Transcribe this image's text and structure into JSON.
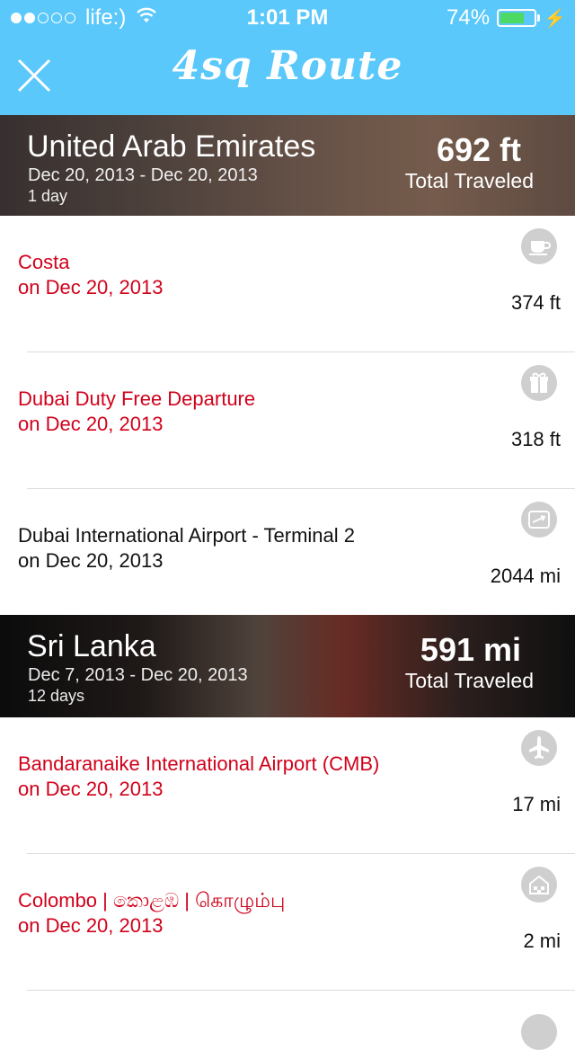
{
  "status_bar": {
    "carrier": "life:)",
    "time": "1:01 PM",
    "battery": "74%",
    "battery_level": 0.74
  },
  "header": {
    "title": "4sq Route"
  },
  "sections": [
    {
      "country": "United Arab Emirates",
      "date_range": "Dec 20, 2013 - Dec 20, 2013",
      "duration": "1 day",
      "total_distance": "692 ft",
      "total_label": "Total Traveled",
      "checkins": [
        {
          "venue": "Costa",
          "date": "on Dec 20, 2013",
          "distance": "374 ft",
          "icon": "coffee-icon",
          "color": "#d0021b"
        },
        {
          "venue": "Dubai Duty Free Departure",
          "date": "on Dec 20, 2013",
          "distance": "318 ft",
          "icon": "gift-icon",
          "color": "#d0021b"
        },
        {
          "venue": "Dubai International Airport - Terminal 2",
          "date": "on Dec 20, 2013",
          "distance": "2044 mi",
          "icon": "terminal-icon",
          "color": "#111111"
        }
      ]
    },
    {
      "country": "Sri Lanka",
      "date_range": "Dec 7, 2013 - Dec 20, 2013",
      "duration": "12 days",
      "total_distance": "591 mi",
      "total_label": "Total Traveled",
      "checkins": [
        {
          "venue": "Bandaranaike International Airport (CMB)",
          "date": "on Dec 20, 2013",
          "distance": "17 mi",
          "icon": "airplane-icon",
          "color": "#d0021b"
        },
        {
          "venue": "Colombo | කොළඹ | கொழும்பு",
          "date": "on Dec 20, 2013",
          "distance": "2 mi",
          "icon": "city-icon",
          "color": "#d0021b"
        }
      ]
    }
  ],
  "colors": {
    "accent": "#5ac8fa",
    "venue_red": "#d0021b",
    "battery_green": "#4cd964"
  }
}
